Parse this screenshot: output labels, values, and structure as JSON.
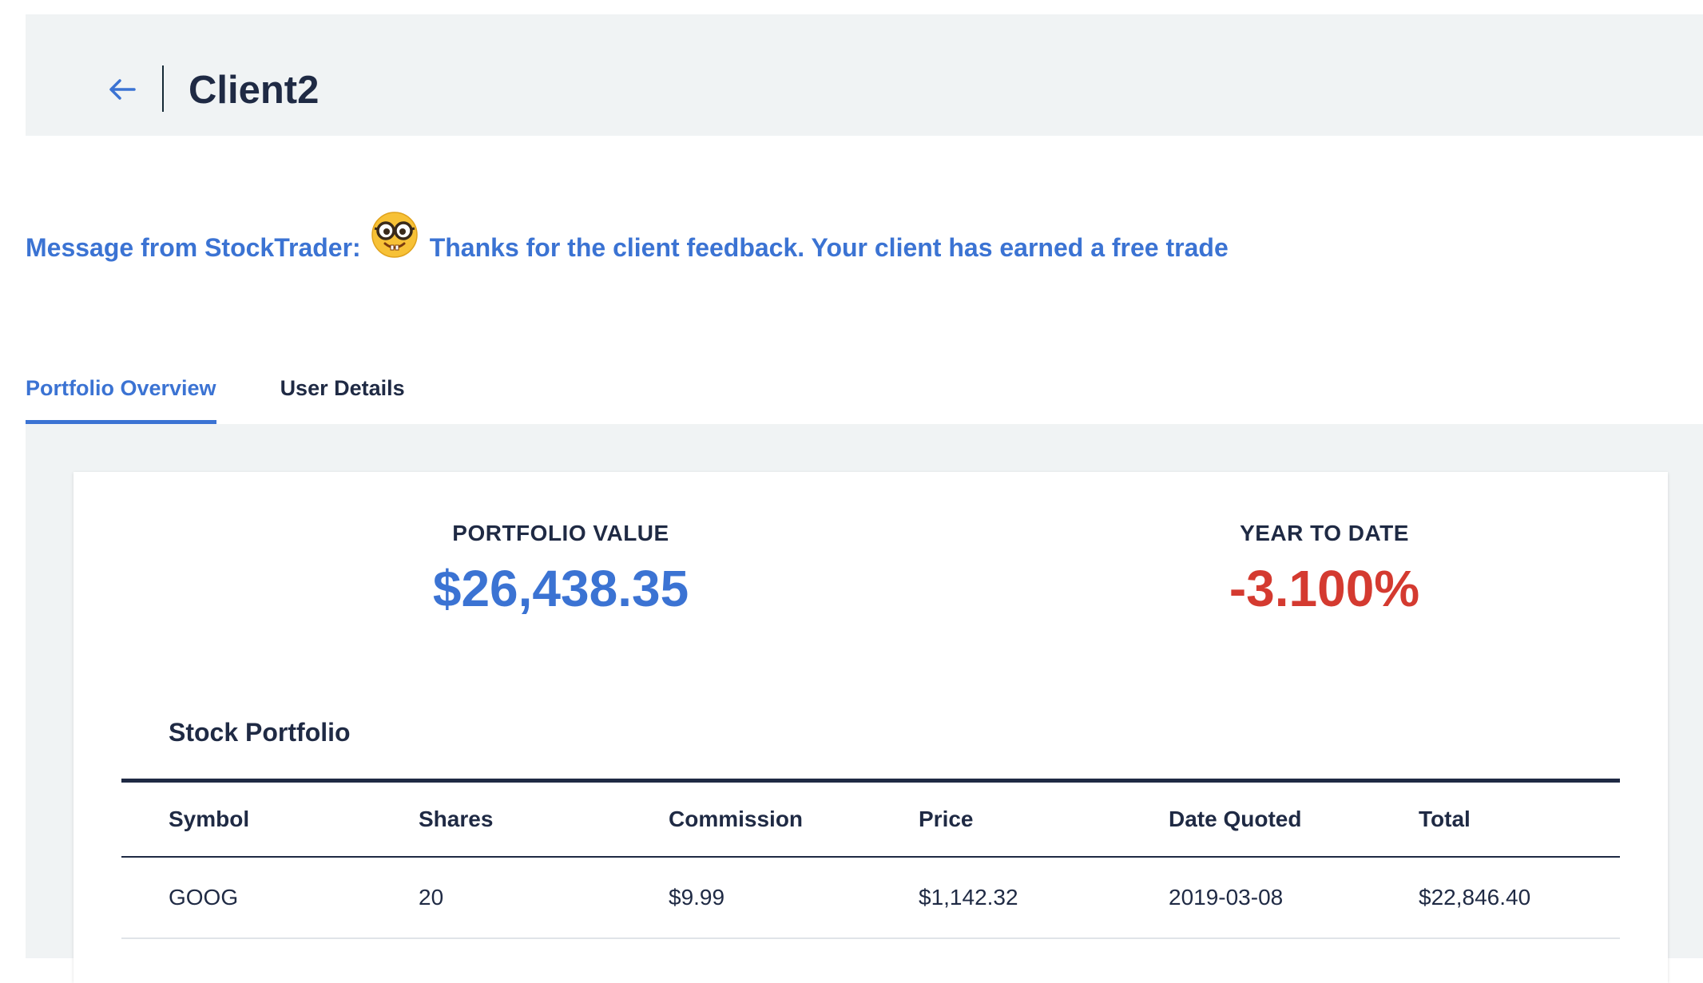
{
  "header": {
    "back_icon": "arrow-left-icon",
    "title": "Client2"
  },
  "message": {
    "prefix": "Message from StockTrader:",
    "emoji_icon": "nerd-face-emoji",
    "text": "Thanks for the client feedback. Your client has earned a free trade"
  },
  "tabs": [
    {
      "label": "Portfolio Overview",
      "active": true
    },
    {
      "label": "User Details",
      "active": false
    }
  ],
  "portfolio": {
    "value_label": "PORTFOLIO VALUE",
    "value": "$26,438.35",
    "ytd_label": "YEAR TO DATE",
    "ytd": "-3.100%"
  },
  "stock_portfolio": {
    "title": "Stock Portfolio",
    "columns": [
      "Symbol",
      "Shares",
      "Commission",
      "Price",
      "Date Quoted",
      "Total"
    ],
    "rows": [
      [
        "GOOG",
        "20",
        "$9.99",
        "$1,142.32",
        "2019-03-08",
        "$22,846.40"
      ]
    ]
  },
  "colors": {
    "accent": "#3b73d3",
    "negative": "#d43a30",
    "text_dark": "#1f2a44",
    "panel_bg": "#f0f3f4"
  }
}
